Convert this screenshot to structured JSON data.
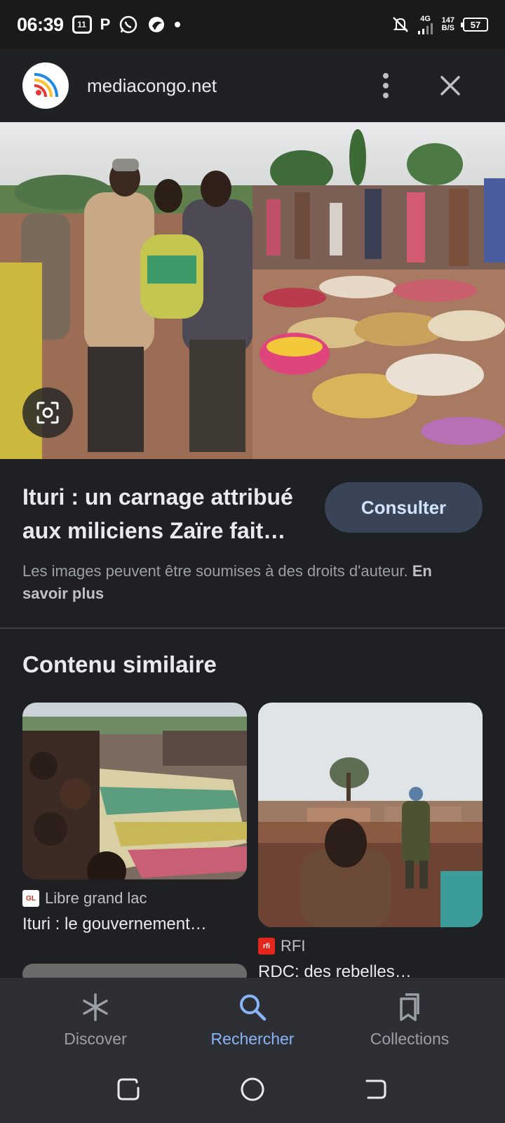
{
  "status_bar": {
    "time": "06:39",
    "network": "4G",
    "speed_value": "147",
    "speed_unit": "B/S",
    "battery": "57"
  },
  "header": {
    "site_name": "mediacongo.net"
  },
  "result": {
    "title": "Ituri : un carnage attribué aux miliciens Zaïre fait…",
    "consult_label": "Consulter",
    "rights_text": "Les images peuvent être soumises à des droits d'auteur.",
    "learn_more": "En savoir plus"
  },
  "similar": {
    "heading": "Contenu similaire",
    "cards": [
      {
        "source": "Libre grand lac",
        "source_logo": "GL",
        "title": "Ituri : le gouvernement…"
      },
      {
        "source": "RFI",
        "source_logo": "rfi",
        "title": "RDC: des rebelles…"
      }
    ]
  },
  "bottom_nav": {
    "items": [
      {
        "label": "Discover",
        "icon": "asterisk-icon"
      },
      {
        "label": "Rechercher",
        "icon": "search-icon"
      },
      {
        "label": "Collections",
        "icon": "bookmarks-icon"
      }
    ],
    "active_index": 1
  },
  "colors": {
    "background": "#1f2024",
    "accent": "#8ab4f8",
    "button_bg": "#394457"
  }
}
